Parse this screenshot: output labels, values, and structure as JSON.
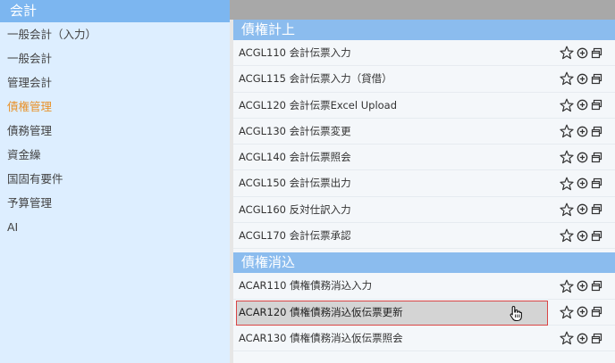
{
  "sidebar": {
    "title": "会計",
    "items": [
      {
        "label": "一般会計（入力）",
        "active": false
      },
      {
        "label": "一般会計",
        "active": false
      },
      {
        "label": "管理会計",
        "active": false
      },
      {
        "label": "債権管理",
        "active": true
      },
      {
        "label": "債務管理",
        "active": false
      },
      {
        "label": "資金繰",
        "active": false
      },
      {
        "label": "国固有要件",
        "active": false
      },
      {
        "label": "予算管理",
        "active": false
      },
      {
        "label": "AI",
        "active": false
      }
    ]
  },
  "sections": [
    {
      "title": "債権計上",
      "rows": [
        {
          "label": "ACGL110 会計伝票入力"
        },
        {
          "label": "ACGL115 会計伝票入力（貸借）"
        },
        {
          "label": "ACGL120 会計伝票Excel Upload"
        },
        {
          "label": "ACGL130 会計伝票変更"
        },
        {
          "label": "ACGL140 会計伝票照会"
        },
        {
          "label": "ACGL150 会計伝票出力"
        },
        {
          "label": "ACGL160 反対仕訳入力"
        },
        {
          "label": "ACGL170 会計伝票承認"
        }
      ]
    },
    {
      "title": "債権消込",
      "rows": [
        {
          "label": "ACAR110 債権債務消込入力"
        },
        {
          "label": "ACAR120 債権債務消込仮伝票更新",
          "selected": true
        },
        {
          "label": "ACAR130 債権債務消込仮伝票照会"
        }
      ]
    }
  ],
  "row_icons": [
    "star-icon",
    "add-circle-icon",
    "new-window-icon"
  ],
  "colors": {
    "sidebar_header": "#7cb6f0",
    "sidebar_bg": "#ddeeff",
    "section_header": "#8bbcee",
    "active_item": "#e8922a",
    "selected_border": "#d94545",
    "selected_bg": "#d4d4d4"
  }
}
